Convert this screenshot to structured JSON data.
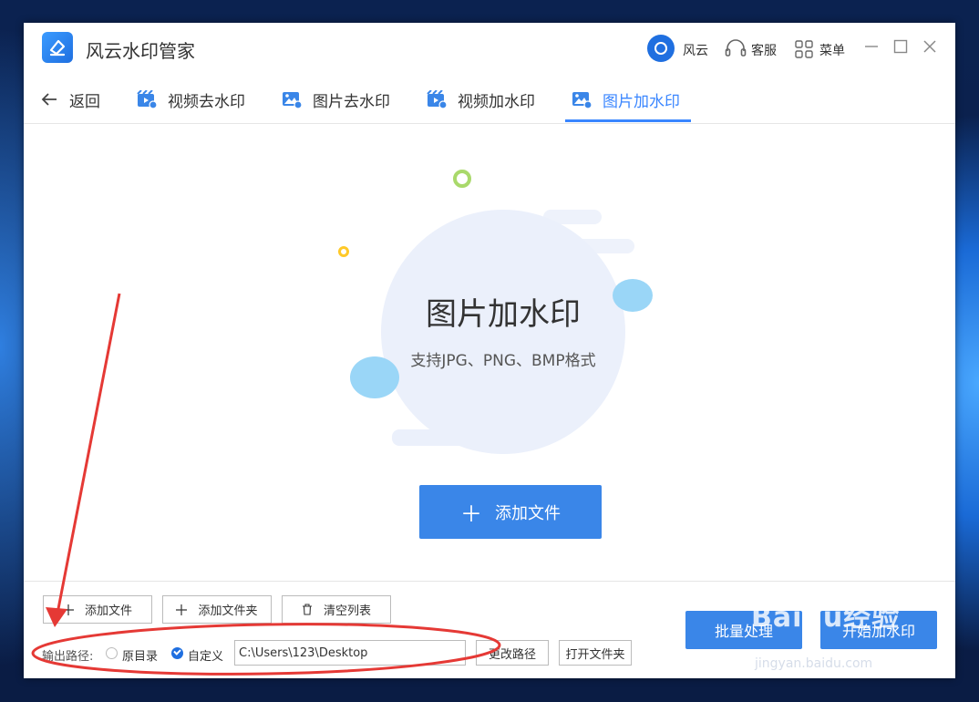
{
  "app": {
    "title": "风云水印管家",
    "user_name": "风云",
    "service_label": "客服",
    "menu_label": "菜单"
  },
  "nav": {
    "back_label": "返回",
    "tabs": [
      {
        "label": "视频去水印",
        "icon": "video-icon"
      },
      {
        "label": "图片去水印",
        "icon": "image-icon"
      },
      {
        "label": "视频加水印",
        "icon": "video-icon"
      },
      {
        "label": "图片加水印",
        "icon": "image-icon",
        "active": true
      }
    ]
  },
  "main": {
    "title": "图片加水印",
    "subtitle": "支持JPG、PNG、BMP格式",
    "add_file_label": "添加文件"
  },
  "toolbar": {
    "add_file_label": "添加文件",
    "add_folder_label": "添加文件夹",
    "clear_list_label": "清空列表",
    "output_path_label": "输出路径:",
    "radio_original_label": "原目录",
    "radio_custom_label": "自定义",
    "selected_output": "自定义",
    "path_value": "C:\\Users\\123\\Desktop",
    "change_path_label": "更改路径",
    "open_folder_label": "打开文件夹",
    "batch_label": "批量处理",
    "start_label": "开始加水印"
  },
  "watermark": {
    "brand": "Baidu经验",
    "url": "jingyan.baidu.com"
  },
  "colors": {
    "accent": "#3a86e8",
    "annotation": "#e53935"
  }
}
